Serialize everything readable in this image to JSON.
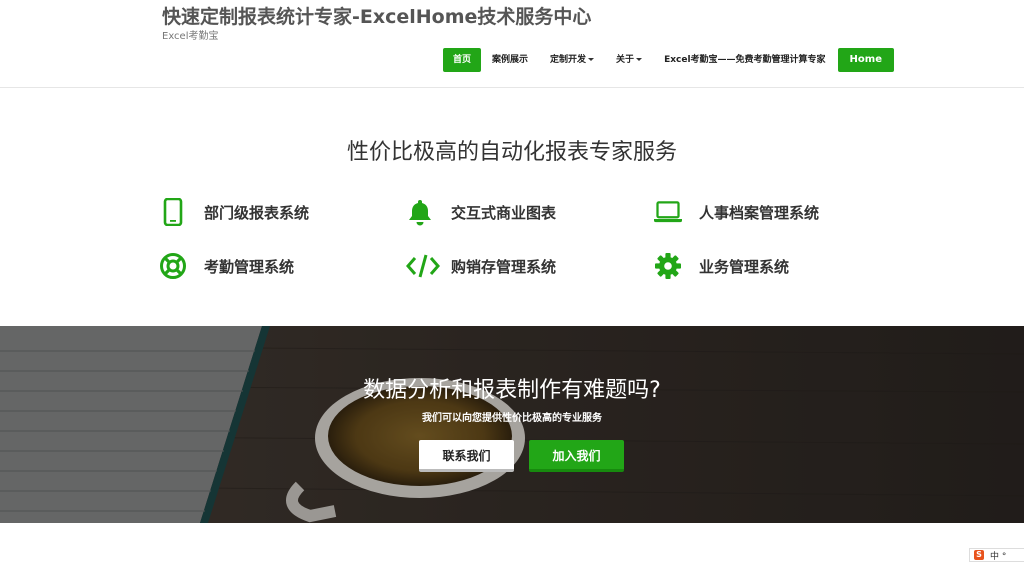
{
  "header": {
    "site_title": "快速定制报表统计专家-ExcelHome技术服务中心",
    "tagline": "Excel考勤宝"
  },
  "nav": {
    "items": [
      {
        "label": "首页",
        "active": true
      },
      {
        "label": "案例展示"
      },
      {
        "label": "定制开发",
        "dropdown": true
      },
      {
        "label": "关于",
        "dropdown": true
      },
      {
        "label": "Excel考勤宝——免费考勤管理计算专家"
      }
    ],
    "home_label": "Home"
  },
  "features": {
    "title": "性价比极高的自动化报表专家服务",
    "items": [
      {
        "label": "部门级报表系统",
        "icon": "mobile-icon"
      },
      {
        "label": "交互式商业图表",
        "icon": "bell-icon"
      },
      {
        "label": "人事档案管理系统",
        "icon": "laptop-icon"
      },
      {
        "label": "考勤管理系统",
        "icon": "life-ring-icon"
      },
      {
        "label": "购销存管理系统",
        "icon": "code-icon"
      },
      {
        "label": "业务管理系统",
        "icon": "gear-icon"
      }
    ]
  },
  "hero": {
    "title": "数据分析和报表制作有难题吗?",
    "subtitle": "我们可以向您提供性价比极高的专业服务",
    "contact_label": "联系我们",
    "join_label": "加入我们"
  },
  "ime": {
    "label": "中 °"
  },
  "colors": {
    "accent": "#22a617",
    "hero_bg": "#3b342e"
  }
}
